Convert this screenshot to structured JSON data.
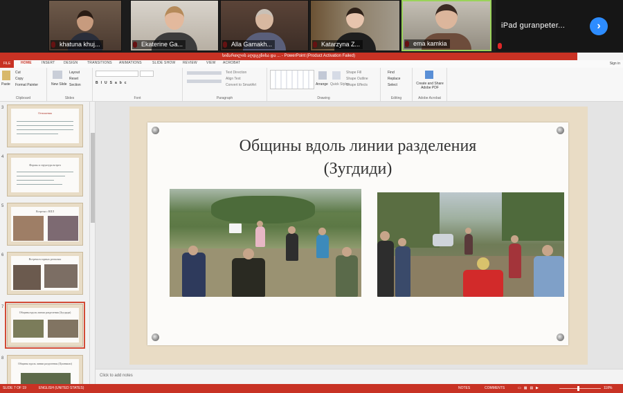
{
  "participants": [
    {
      "name": "khatuna khuj...",
      "muted": true
    },
    {
      "name": "Ekaterine Ga...",
      "muted": true
    },
    {
      "name": "Alla Gamakh...",
      "muted": true
    },
    {
      "name": "Katarzyna Z...",
      "muted": true
    },
    {
      "name": "ema kamkia",
      "muted": true
    },
    {
      "name": "iPad  guranpeter...",
      "muted": true
    }
  ],
  "ppt": {
    "title": "სიმართლის აღდგენისა და ... - PowerPoint (Product Activation Failed)",
    "file_tab": "FILE",
    "tabs": [
      "HOME",
      "INSERT",
      "DESIGN",
      "TRANSITIONS",
      "ANIMATIONS",
      "SLIDE SHOW",
      "REVIEW",
      "VIEW",
      "ACROBAT"
    ],
    "sign_in": "Sign in",
    "ribbon": {
      "paste": "Paste",
      "cut": "Cut",
      "copy": "Copy",
      "format_painter": "Format Painter",
      "clipboard": "Clipboard",
      "new_slide": "New Slide",
      "layout": "Layout",
      "reset": "Reset",
      "section": "Section",
      "slides": "Slides",
      "font": "Font",
      "text_direction": "Text Direction",
      "align_text": "Align Text",
      "convert_smartart": "Convert to SmartArt",
      "paragraph": "Paragraph",
      "arrange": "Arrange",
      "quick_styles": "Quick Styles",
      "shape_fill": "Shape Fill",
      "shape_outline": "Shape Outline",
      "shape_effects": "Shape Effects",
      "drawing": "Drawing",
      "find": "Find",
      "replace": "Replace",
      "select": "Select",
      "editing": "Editing",
      "create_share_pdf": "Create and Share Adobe PDF",
      "adobe_acrobat": "Adobe Acrobat"
    },
    "thumbnails": [
      {
        "num": "3",
        "title": "Отношения"
      },
      {
        "num": "4",
        "title": "Формы и структура встреч"
      },
      {
        "num": "5",
        "title": "Встречи с ВПЛ"
      },
      {
        "num": "6",
        "title": "Встречи в горных регионах"
      },
      {
        "num": "7",
        "title": "Общины вдоль линии разделения (Зугдиди)",
        "selected": true
      },
      {
        "num": "8",
        "title": "Общины вдоль линии разделения (Цхинвали)"
      }
    ],
    "slide": {
      "title_line1": "Общины вдоль линии разделения",
      "title_line2": "(Зугдиди)"
    },
    "notes_placeholder": "Click to add notes",
    "status": {
      "slide_count": "SLIDE 7 OF 19",
      "language": "ENGLISH (UNITED STATES)",
      "notes": "NOTES",
      "comments": "COMMENTS",
      "zoom": "118%"
    }
  }
}
